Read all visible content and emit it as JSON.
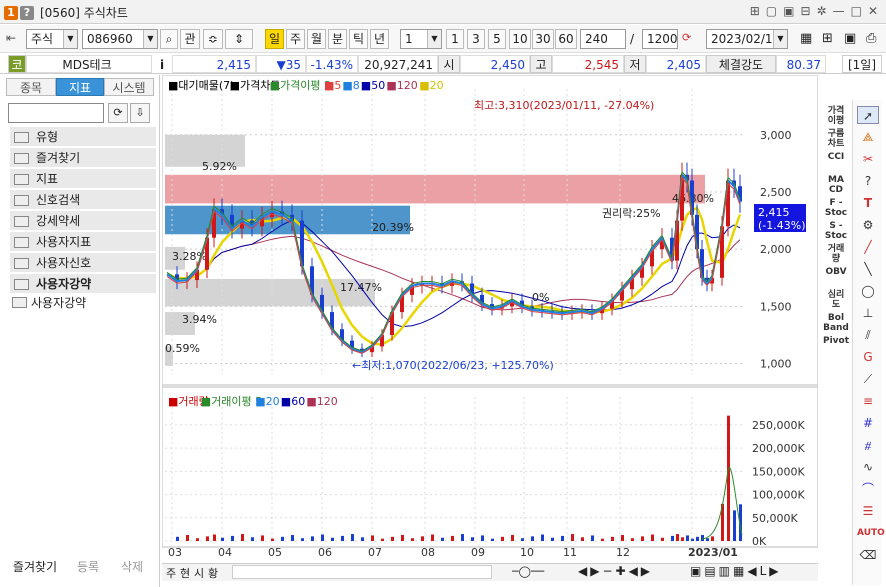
{
  "window": {
    "badge_help": "?",
    "badge_num": "1",
    "title": "[0560] 주식차트",
    "controls": [
      "⊞",
      "▢",
      "▣",
      "⊟",
      "✲",
      "—",
      "□",
      "✕"
    ]
  },
  "toolbar": {
    "market": "주식",
    "code": "086960",
    "btn_kwan": "관",
    "periods": [
      "일",
      "주",
      "월",
      "분",
      "틱",
      "년"
    ],
    "active_period": "일",
    "num_select": "1",
    "nums": [
      "1",
      "3",
      "5",
      "10",
      "30",
      "60"
    ],
    "count": "240",
    "slash": "/",
    "total": "1200",
    "date": "2023/02/16"
  },
  "quote": {
    "kind": "코",
    "name": "MDS테크",
    "info": "i",
    "price": "2,415",
    "change": "▼35",
    "pct": "-1.43%",
    "volume": "20,927,241",
    "open_label": "시",
    "open": "2,450",
    "high_label": "고",
    "high": "2,545",
    "low_label": "저",
    "low": "2,405",
    "strength_label": "체결강도",
    "strength": "80.37",
    "period_label": "[1일]"
  },
  "left": {
    "tabs": [
      "종목",
      "지표",
      "시스템"
    ],
    "active_tab": "지표",
    "tree": [
      "유형",
      "즐겨찾기",
      "지표",
      "신호검색",
      "강세약세",
      "사용자지표",
      "사용자신호",
      "사용자강약"
    ],
    "subitem": "사용자강약",
    "bottom": [
      "즐겨찾기",
      "등록",
      "삭제"
    ]
  },
  "upper": {
    "legend": [
      {
        "text": "■대기매물(7)",
        "color": "#000000"
      },
      {
        "text": "■가격차트",
        "color": "#000000"
      },
      {
        "text": "■가격이평 3",
        "color": "#2a8a2a"
      },
      {
        "text": "■5",
        "color": "#e04040"
      },
      {
        "text": "■8",
        "color": "#2080e0"
      },
      {
        "text": "■50",
        "color": "#0000aa"
      },
      {
        "text": "■120",
        "color": "#aa3355"
      },
      {
        "text": "■20",
        "color": "#d8c000"
      }
    ],
    "yticks": [
      "3,000",
      "2,500",
      "2,000",
      "1,500",
      "1,000"
    ],
    "high_label": "최고:3,310(2023/01/11, -27.04%)",
    "low_label": "←최저:1,070(2022/06/23, +125.70%)",
    "vp_labels": [
      "5.92%",
      "46.80%",
      "20.39%",
      "3.28%",
      "17.47%",
      "3.94%",
      "0.59%"
    ],
    "rights": "권리락:25%",
    "price_tag": "2,415",
    "price_tag2": "(-1.43%)",
    "mid_note": "0%"
  },
  "lower": {
    "legend": [
      {
        "text": "■거래량",
        "color": "#cc0000"
      },
      {
        "text": "■거래이평 5",
        "color": "#2a8a2a"
      },
      {
        "text": "■20",
        "color": "#2080e0"
      },
      {
        "text": "■60",
        "color": "#0000aa"
      },
      {
        "text": "■120",
        "color": "#aa3355"
      }
    ],
    "yticks": [
      "250,000K",
      "200,000K",
      "150,000K",
      "100,000K",
      "50,000K",
      "0K"
    ]
  },
  "xaxis": [
    "03",
    "04",
    "05",
    "06",
    "07",
    "08",
    "09",
    "10",
    "11",
    "12",
    "2023/01"
  ],
  "bottombar": {
    "tabs": [
      "주",
      "현",
      "시",
      "황"
    ]
  },
  "rightcol1": [
    "가격\n이평",
    "구름\n차트",
    "CCI",
    "MA\nCD",
    "F -\nStoc",
    "S -\nStoc",
    "거래\n량",
    "OBV",
    "심리\n도",
    "Bol\nBand",
    "Pivot"
  ],
  "icons": {
    "cursor": "cursor-icon",
    "paint": "paint-icon",
    "help": "help-icon",
    "text": "text-icon",
    "settings": "settings-icon",
    "circle": "circle-icon"
  }
}
